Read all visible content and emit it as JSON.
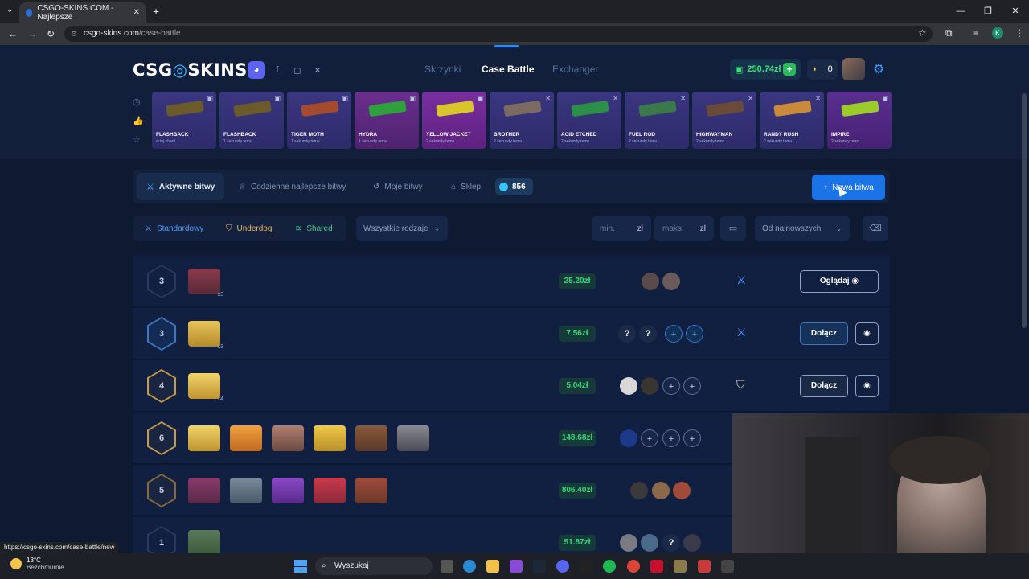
{
  "browser": {
    "tab_title": "CSGO-SKINS.COM - Najlepsze",
    "url_host": "csgo-skins.com",
    "url_path": "/case-battle",
    "profile_initial": "K",
    "status_url": "https://csgo-skins.com/case-battle/new"
  },
  "site": {
    "logo_left": "CSG",
    "logo_right": "SKINS",
    "nav": [
      "Skrzynki",
      "Case Battle",
      "Exchanger"
    ],
    "balance": "250.74zł",
    "coins": "0"
  },
  "drops": [
    {
      "name": "FLASHBACK",
      "sub": "w tej chwili",
      "color": "#6b5a2a"
    },
    {
      "name": "FLASHBACK",
      "sub": "1 sekundę temu",
      "color": "#6b5a2a"
    },
    {
      "name": "TIGER MOTH",
      "sub": "1 sekundę temu",
      "color": "#a34a2f"
    },
    {
      "name": "HYDRA",
      "sub": "1 sekundę temu",
      "color": "#2fa03b"
    },
    {
      "name": "YELLOW JACKET",
      "sub": "2 sekundy temu",
      "color": "#d8c52a"
    },
    {
      "name": "BROTHER",
      "sub": "2 sekundy temu",
      "color": "#7a6a62"
    },
    {
      "name": "ACID ETCHED",
      "sub": "2 sekundy temu",
      "color": "#2c8f48"
    },
    {
      "name": "FUEL ROD",
      "sub": "2 sekundy temu",
      "color": "#3a7a4a"
    },
    {
      "name": "HIGHWAYMAN",
      "sub": "2 sekundy temu",
      "color": "#6a4a38"
    },
    {
      "name": "RANDY RUSH",
      "sub": "2 sekundy temu",
      "color": "#c98a3a"
    },
    {
      "name": "IMPIRE",
      "sub": "2 sekundy temu",
      "color": "#9ccc2a"
    }
  ],
  "tabs": {
    "active": "Aktywne bitwy",
    "daily": "Codzienne najlepsze bitwy",
    "mine": "Moje bitwy",
    "shop": "Sklep",
    "count": "856",
    "new_battle": "Nowa bitwa"
  },
  "modes": {
    "standard": "Standardowy",
    "underdog": "Underdog",
    "shared": "Shared",
    "all_types": "Wszystkie rodzaje",
    "min": "min.",
    "max": "maks.",
    "currency": "zł",
    "sort": "Od najnowszych"
  },
  "battles": [
    {
      "rounds": "3",
      "mult": "x3",
      "price": "25.20zł",
      "action": "Oglądaj"
    },
    {
      "rounds": "3",
      "mult": "x3",
      "price": "7.56zł",
      "action": "Dołącz"
    },
    {
      "rounds": "4",
      "mult": "x4",
      "price": "5.04zł",
      "action": "Dołącz"
    },
    {
      "rounds": "6",
      "mult": "",
      "price": "148.68zł",
      "action": ""
    },
    {
      "rounds": "5",
      "mult": "",
      "price": "806.40zł",
      "action": ""
    },
    {
      "rounds": "1",
      "mult": "",
      "price": "51.87zł",
      "action": ""
    }
  ],
  "taskbar": {
    "temp": "13°C",
    "weather": "Bezchmurnie",
    "search": "Wyszukaj"
  }
}
